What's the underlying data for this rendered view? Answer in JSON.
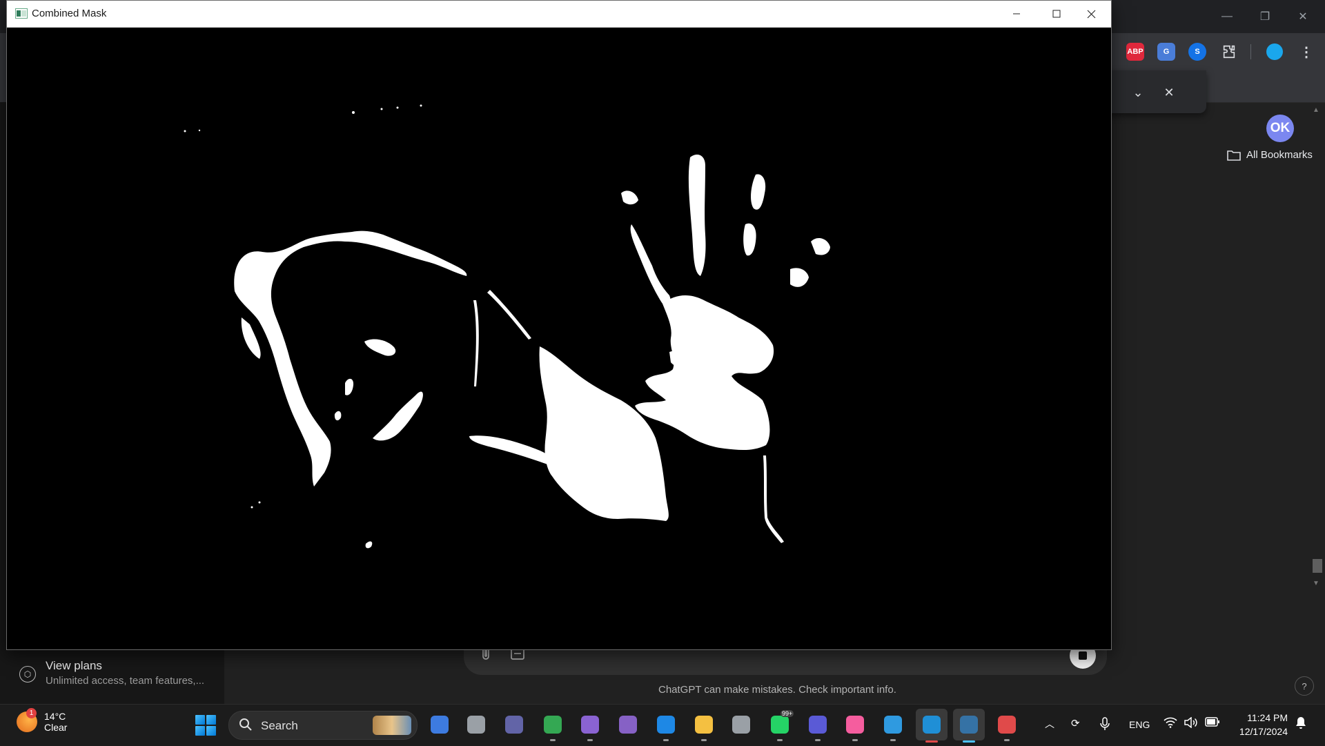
{
  "mask_window": {
    "title": "Combined Mask",
    "minimize_glyph": "—",
    "maximize_glyph": "☐",
    "close_glyph": "✕"
  },
  "browser": {
    "extensions": [
      {
        "name": "adblock-plus-icon",
        "label": "ABP",
        "color": "#e0283c"
      },
      {
        "name": "google-translate-icon",
        "label": "G",
        "color": "#4a7dd8"
      },
      {
        "name": "shazam-icon",
        "label": "S",
        "color": "#1473e6"
      },
      {
        "name": "extensions-puzzle-icon",
        "label": "",
        "color": "#35363a"
      }
    ],
    "bookmarks_label": "All Bookmarks",
    "find_bar": {
      "prev": "⌃",
      "next": "⌄",
      "close": "✕"
    }
  },
  "chatgpt": {
    "avatar_initials": "OK",
    "view_plans_title": "View plans",
    "view_plans_subtitle": "Unlimited access, team features,...",
    "disclaimer": "ChatGPT can make mistakes. Check important info.",
    "help": "?"
  },
  "taskbar": {
    "weather_temp": "14°C",
    "weather_condition": "Clear",
    "weather_badge": "1",
    "search_label": "Search",
    "apps": [
      {
        "name": "copilot-pre-icon",
        "color": "#3d7be0"
      },
      {
        "name": "task-view-icon",
        "color": "#9aa0a6"
      },
      {
        "name": "teams-icon",
        "color": "#6264a7"
      },
      {
        "name": "chrome-icon",
        "color": "#34a853"
      },
      {
        "name": "power-automate-icon",
        "color": "#8a63d2"
      },
      {
        "name": "visual-studio-icon",
        "color": "#8661c5"
      },
      {
        "name": "vscode-icon",
        "color": "#1e88e5"
      },
      {
        "name": "file-explorer-icon",
        "color": "#f4c041"
      },
      {
        "name": "virtualbox-icon",
        "color": "#9aa0a6"
      },
      {
        "name": "whatsapp-icon",
        "color": "#25d366"
      },
      {
        "name": "cortana-icon",
        "color": "#5a5ad6"
      },
      {
        "name": "itunes-icon",
        "color": "#f55d9e"
      },
      {
        "name": "notepad-icon",
        "color": "#2f9ae0"
      },
      {
        "name": "paint-icon",
        "color": "#1f8fd6"
      },
      {
        "name": "python-icon",
        "color": "#3572a5"
      },
      {
        "name": "snipping-tool-icon",
        "color": "#e04a4a"
      }
    ],
    "whatsapp_badge": "99+",
    "language": "ENG",
    "time": "11:24 PM",
    "date": "12/17/2024"
  }
}
